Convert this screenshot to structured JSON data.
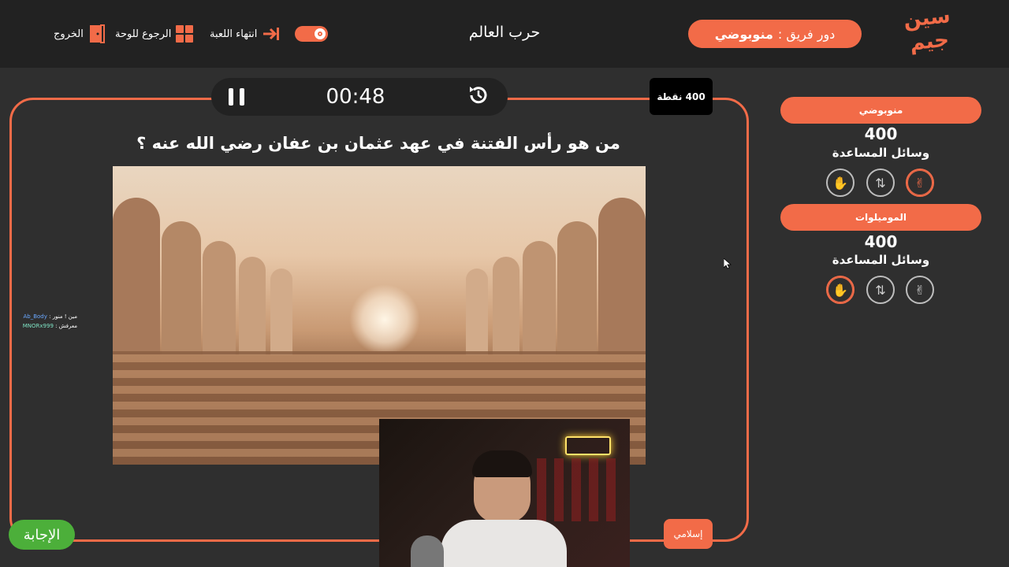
{
  "topbar": {
    "logo_line1": "سين",
    "logo_line2": "جيم",
    "turn_label": "دور فريق :",
    "turn_team": "منوبوضي",
    "game_title": "حرب العالم",
    "end_game_label": "انتهاء اللعبة",
    "back_to_board_label": "الرجوع للوحة",
    "exit_label": "الخروج"
  },
  "timer": {
    "time": "00:48"
  },
  "points_badge": "400 نقطة",
  "question": "من هو رأس الفتنة في عهد عثمان بن عفان رضي الله عنه ؟",
  "answer_button": "الإجابة",
  "category_button": "إسلامي",
  "chat": {
    "line1_prefix": "مين ! منور :",
    "line1_user": "Ab_Body",
    "line2_prefix": "معرفش :",
    "line2_user": "MNORx999"
  },
  "teams": [
    {
      "name": "منوبوضي",
      "score": "400",
      "aids_label": "وسائل المساعدة"
    },
    {
      "name": "الموميلوات",
      "score": "400",
      "aids_label": "وسائل المساعدة"
    }
  ],
  "colors": {
    "accent": "#f26b48",
    "answer": "#4caf3a",
    "background": "#2f2f2f",
    "topbar": "#222222"
  },
  "icons": {
    "end_game": "arrow-right-to-bar-icon",
    "back_board": "grid-icon",
    "exit": "door-exit-icon",
    "pause": "pause-icon",
    "restart": "history-icon",
    "aid_hand": "hand-icon",
    "aid_swap": "two-way-icon",
    "aid_peace": "peace-hand-icon"
  }
}
